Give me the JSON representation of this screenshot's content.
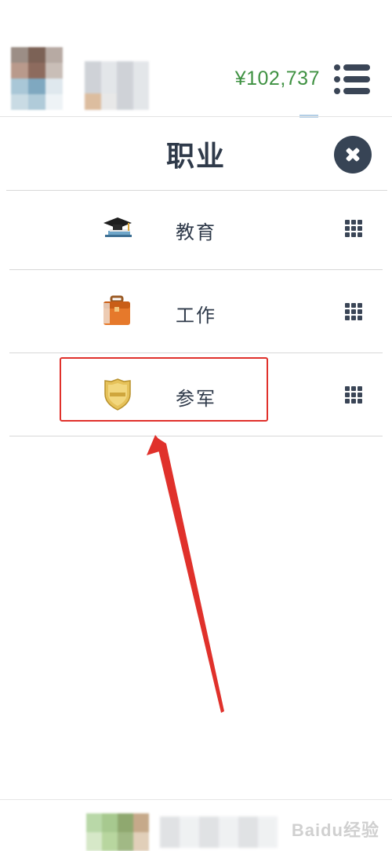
{
  "header": {
    "balance": "¥102,737",
    "menu_icon": "list-menu-icon"
  },
  "panel": {
    "title": "职业",
    "close_icon": "close-icon"
  },
  "items": [
    {
      "label": "教育",
      "icon": "graduation-cap-icon"
    },
    {
      "label": "工作",
      "icon": "briefcase-icon"
    },
    {
      "label": "参军",
      "icon": "police-badge-icon"
    }
  ],
  "colors": {
    "balance": "#3f9142",
    "dark": "#374455",
    "highlight": "#e0312b"
  },
  "watermark": "Baidu经验"
}
